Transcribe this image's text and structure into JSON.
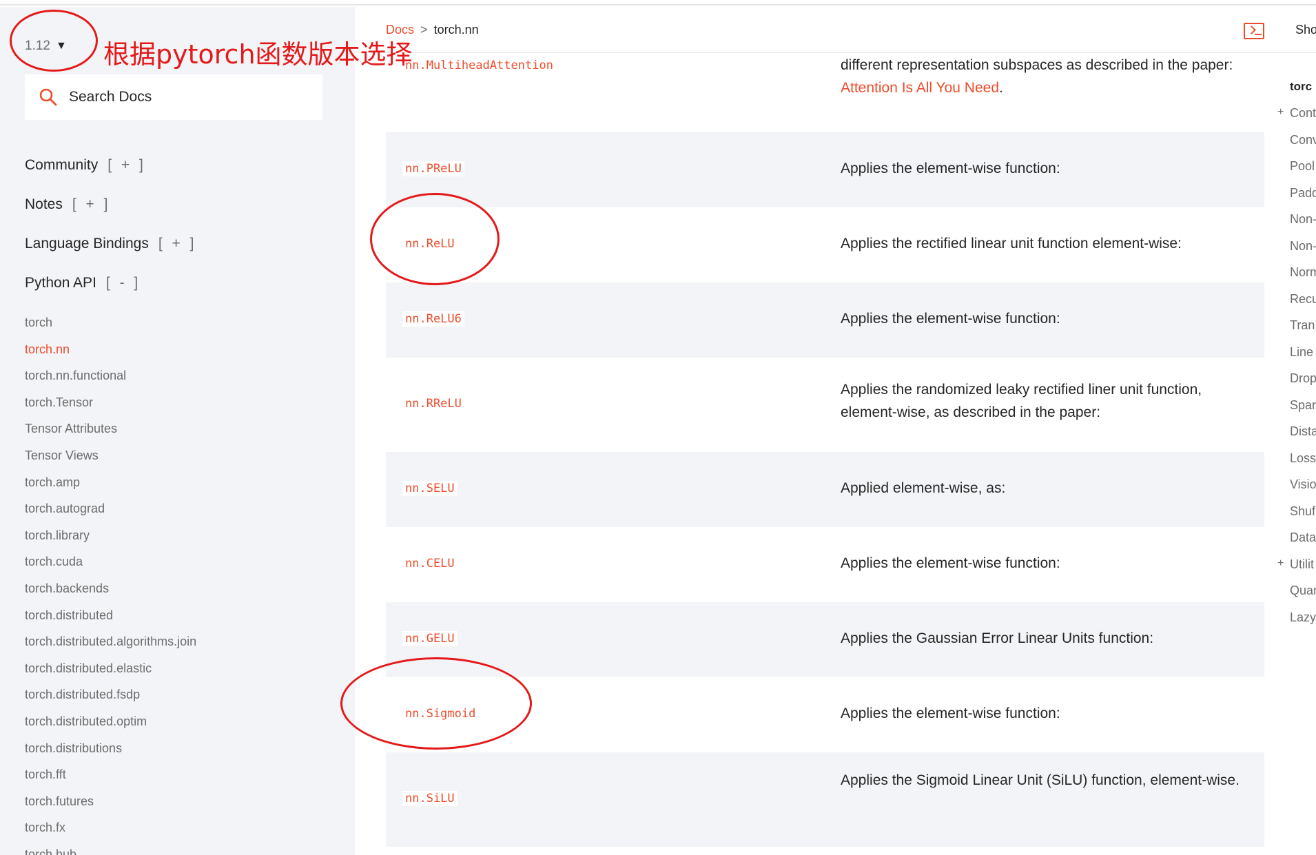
{
  "sidebar": {
    "version": "1.12",
    "search_placeholder": "Search Docs",
    "sections": [
      {
        "label": "Community",
        "toggle": "[ + ]"
      },
      {
        "label": "Notes",
        "toggle": "[ + ]"
      },
      {
        "label": "Language Bindings",
        "toggle": "[ + ]"
      },
      {
        "label": "Python API",
        "toggle": "[ - ]"
      }
    ],
    "nav_items": [
      "torch",
      "torch.nn",
      "torch.nn.functional",
      "torch.Tensor",
      "Tensor Attributes",
      "Tensor Views",
      "torch.amp",
      "torch.autograd",
      "torch.library",
      "torch.cuda",
      "torch.backends",
      "torch.distributed",
      "torch.distributed.algorithms.join",
      "torch.distributed.elastic",
      "torch.distributed.fsdp",
      "torch.distributed.optim",
      "torch.distributions",
      "torch.fft",
      "torch.futures",
      "torch.fx",
      "torch.hub"
    ],
    "active_item": "torch.nn"
  },
  "annotation": {
    "text": "根据pytorch函数版本选择"
  },
  "header": {
    "breadcrumb_root": "Docs",
    "breadcrumb_sep": ">",
    "breadcrumb_current": "torch.nn",
    "show_label": "Sho"
  },
  "rows": [
    {
      "code": "nn.MultiheadAttention",
      "desc_before": "different representation subspaces as described in the paper: ",
      "desc_link": "Attention Is All You Need",
      "desc_after": "."
    },
    {
      "code": "nn.PReLU",
      "desc": "Applies the element-wise function:"
    },
    {
      "code": "nn.ReLU",
      "desc": "Applies the rectified linear unit function element-wise:"
    },
    {
      "code": "nn.ReLU6",
      "desc": "Applies the element-wise function:"
    },
    {
      "code": "nn.RReLU",
      "desc": "Applies the randomized leaky rectified liner unit function, element-wise, as described in the paper:"
    },
    {
      "code": "nn.SELU",
      "desc": "Applied element-wise, as:"
    },
    {
      "code": "nn.CELU",
      "desc": "Applies the element-wise function:"
    },
    {
      "code": "nn.GELU",
      "desc": "Applies the Gaussian Error Linear Units function:"
    },
    {
      "code": "nn.Sigmoid",
      "desc": "Applies the element-wise function:"
    },
    {
      "code": "nn.SiLU",
      "desc": "Applies the Sigmoid Linear Unit (SiLU) function, element-wise."
    }
  ],
  "toc": {
    "title": "torc",
    "items": [
      {
        "label": "Cont",
        "plus": "+"
      },
      {
        "label": "Conv",
        "plus": ""
      },
      {
        "label": "Pool",
        "plus": ""
      },
      {
        "label": "Padd",
        "plus": ""
      },
      {
        "label": "Non-",
        "plus": ""
      },
      {
        "label": "Non-",
        "plus": ""
      },
      {
        "label": "Norm",
        "plus": ""
      },
      {
        "label": "Recu",
        "plus": ""
      },
      {
        "label": "Tran",
        "plus": ""
      },
      {
        "label": "Line",
        "plus": ""
      },
      {
        "label": "Drop",
        "plus": ""
      },
      {
        "label": "Spar",
        "plus": ""
      },
      {
        "label": "Dista",
        "plus": ""
      },
      {
        "label": "Loss",
        "plus": ""
      },
      {
        "label": "Visio",
        "plus": ""
      },
      {
        "label": "Shuf",
        "plus": ""
      },
      {
        "label": "Data",
        "plus": ""
      },
      {
        "label": "Utilit",
        "plus": "+"
      },
      {
        "label": "Quar",
        "plus": ""
      },
      {
        "label": "Lazy",
        "plus": ""
      }
    ]
  }
}
